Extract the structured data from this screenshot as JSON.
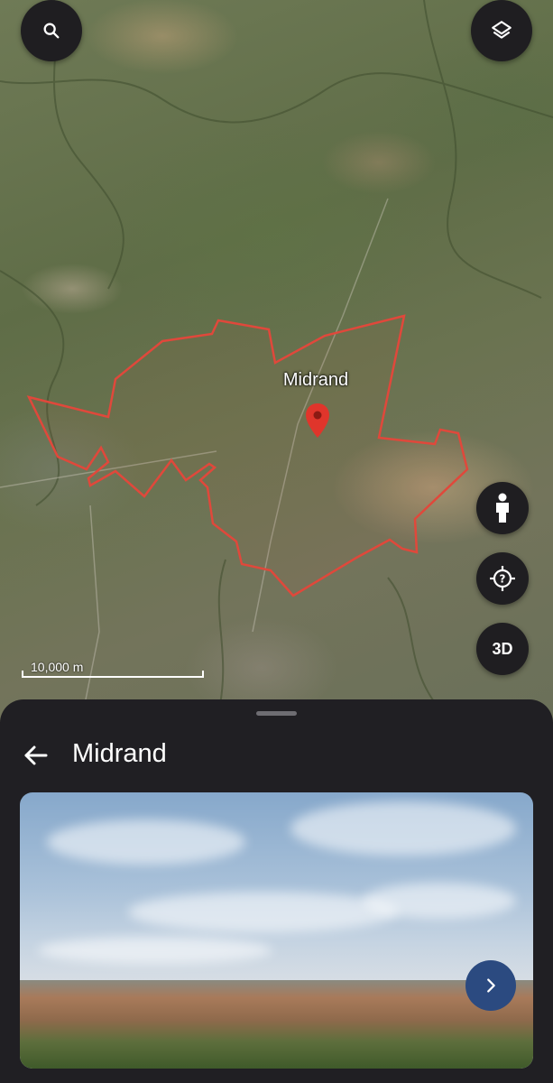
{
  "map": {
    "place_label": "Midrand",
    "scale_label": "10,000 m",
    "boundary_color": "#e0483b",
    "pin_color": "#e0352b"
  },
  "controls": {
    "search_icon": "search-icon",
    "layers_icon": "layers-icon",
    "pegman_icon": "street-view-pegman-icon",
    "locate_icon": "my-location-icon",
    "three_d_label": "3D"
  },
  "sheet": {
    "title": "Midrand",
    "back_icon": "arrow-back-icon",
    "photo_next_icon": "chevron-right-icon"
  }
}
